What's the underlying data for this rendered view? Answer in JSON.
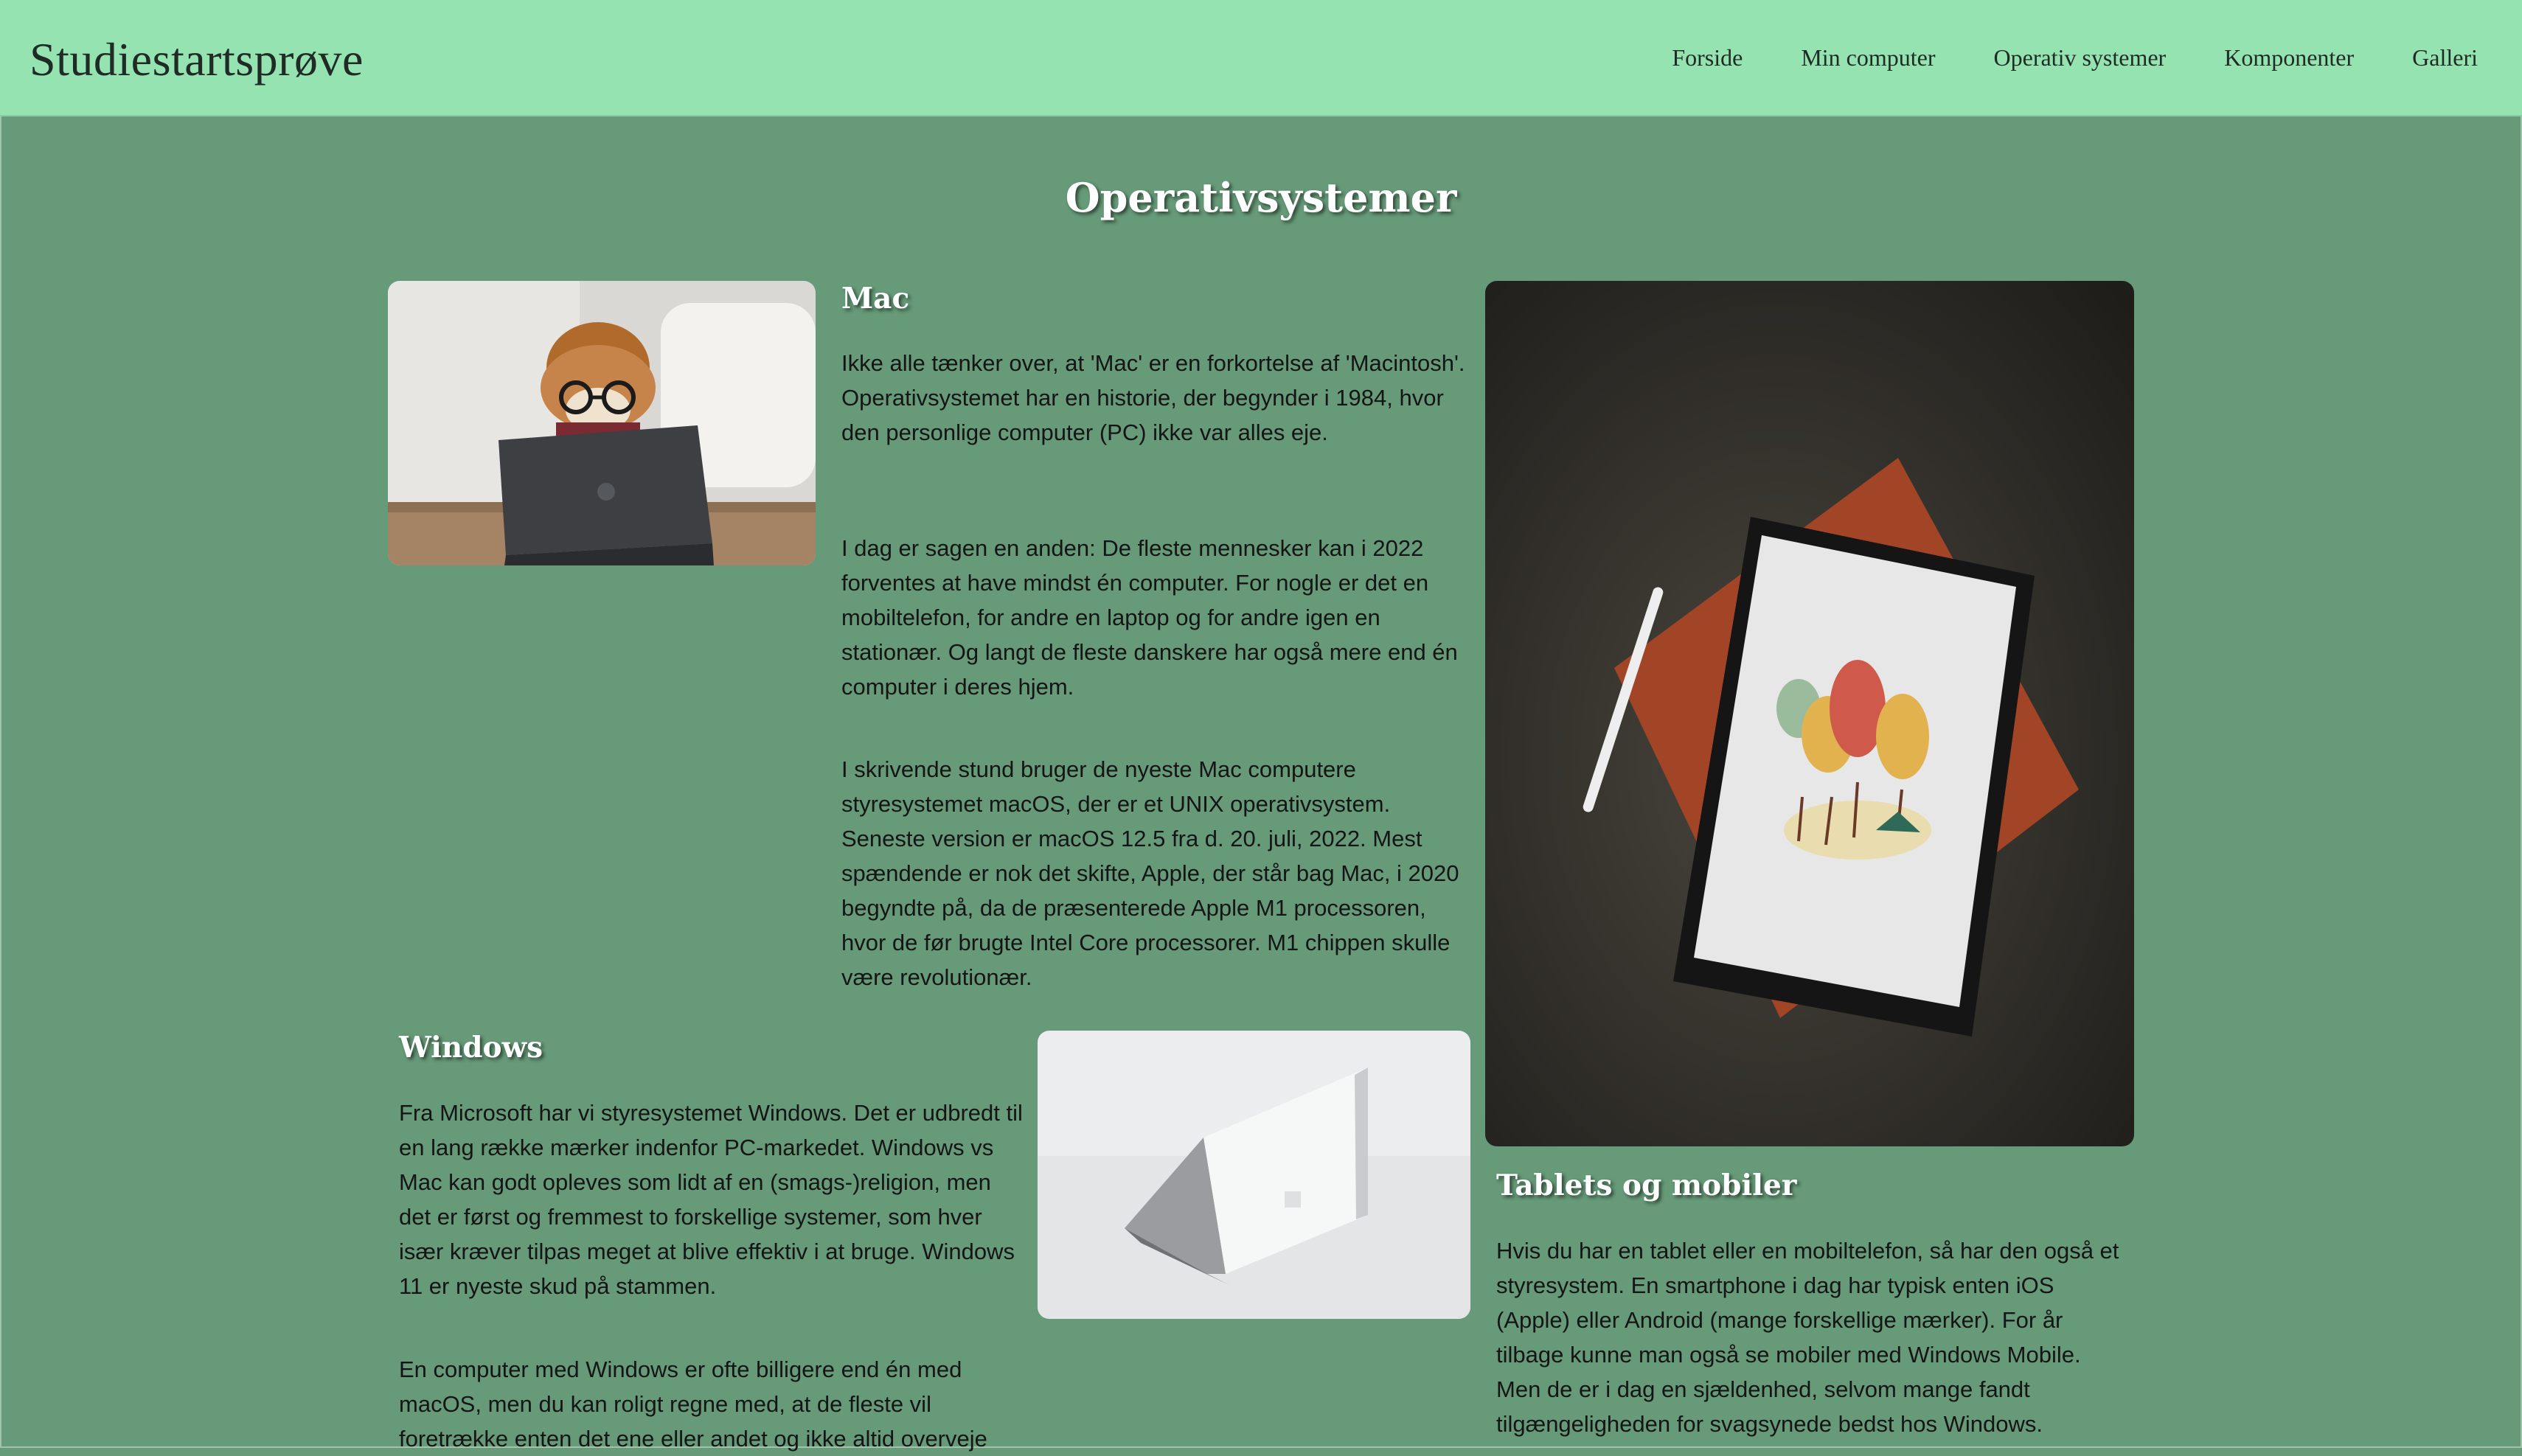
{
  "header": {
    "brand": "Studiestartsprøve",
    "nav": [
      "Forside",
      "Min computer",
      "Operativ systemer",
      "Komponenter",
      "Galleri"
    ]
  },
  "main": {
    "title": "Operativsystemer",
    "mac": {
      "heading": "Mac",
      "paragraphs": [
        "Ikke alle tænker over, at 'Mac' er en forkortelse af 'Macintosh'. Operativsystemet har en historie, der begynder i 1984, hvor den personlige computer (PC) ikke var alles eje.",
        "I dag er sagen en anden: De fleste mennesker kan i 2022 forventes at have mindst én computer. For nogle er det en mobiltelefon, for andre en laptop og for andre igen en stationær. Og langt de fleste danskere har også mere end én computer i deres hjem.",
        "I skrivende stund bruger de nyeste Mac computere styresystemet macOS, der er et UNIX operativsystem. Seneste version er macOS 12.5 fra d. 20. juli, 2022. Mest spændende er nok det skifte, Apple, der står bag Mac, i 2020 begyndte på, da de præsenterede Apple M1 processoren, hvor de før brugte Intel Core processorer. M1 chippen skulle være revolutionær."
      ]
    },
    "windows": {
      "heading": "Windows",
      "paragraphs": [
        "Fra Microsoft har vi styresystemet Windows. Det er udbredt til en lang række mærker indenfor PC-markedet. Windows vs Mac kan godt opleves som lidt af en (smags-)religion, men det er først og fremmest to forskellige systemer, som hver især kræver tilpas meget at blive effektiv i at bruge. Windows 11 er nyeste skud på stammen.",
        "En computer med Windows er ofte billigere end én med macOS, men du kan roligt regne med, at de fleste vil foretrække enten det ene eller andet og ikke altid overveje"
      ]
    },
    "tablets": {
      "heading": "Tablets og mobiler",
      "paragraphs": [
        "Hvis du har en tablet eller en mobiltelefon, så har den også et styresystem. En smartphone i dag har typisk enten iOS (Apple) eller Android (mange forskellige mærker). For år tilbage kunne man også se mobiler med Windows Mobile. Men de er i dag en sjældenhed, selvom mange fandt tilgængeligheden for svagsynede bedst hos Windows."
      ]
    }
  },
  "colors": {
    "page_background": "#669a78",
    "header_background": "#95e3b0",
    "heading_text": "#ffffff",
    "body_text": "#151515"
  }
}
